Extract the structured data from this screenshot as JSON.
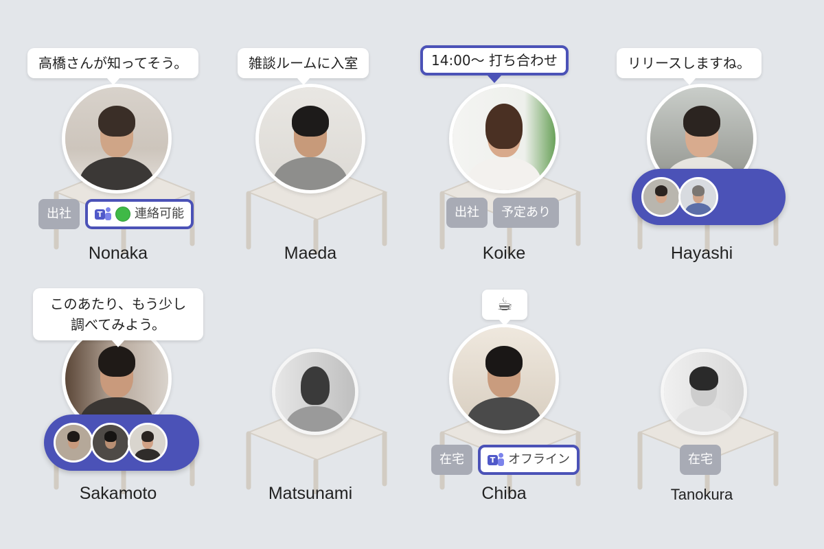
{
  "members": [
    {
      "name": "Nonaka",
      "message": "高橋さんが知ってそう。",
      "tags": [
        "出社"
      ],
      "teams": {
        "icon": "teams-icon",
        "label": "連絡可能",
        "status_color": "#3fb947"
      }
    },
    {
      "name": "Maeda",
      "message": "雑談ルームに入室",
      "tags": []
    },
    {
      "name": "Koike",
      "message": "14:00〜 打ち合わせ",
      "tags": [
        "出社",
        "予定あり"
      ]
    },
    {
      "name": "Hayashi",
      "message": "リリースしますね。",
      "tags": [],
      "group_size": 2
    },
    {
      "name": "Sakamoto",
      "message_lines": [
        "このあたり、もう少し",
        "調べてみよう。"
      ],
      "tags": [],
      "group_size": 3
    },
    {
      "name": "Matsunami",
      "tags": []
    },
    {
      "name": "Chiba",
      "status_icon": "coffee-cup-icon",
      "status_emoji": "☕",
      "tags": [
        "在宅"
      ],
      "teams": {
        "icon": "teams-icon",
        "label": "オフライン"
      }
    },
    {
      "name": "Tanokura",
      "tags": [
        "在宅"
      ]
    }
  ],
  "colors": {
    "background": "#e3e6ea",
    "accent": "#4b52b7",
    "tag": "#a8abb5",
    "desk": "#e9e5df",
    "available": "#3fb947"
  }
}
